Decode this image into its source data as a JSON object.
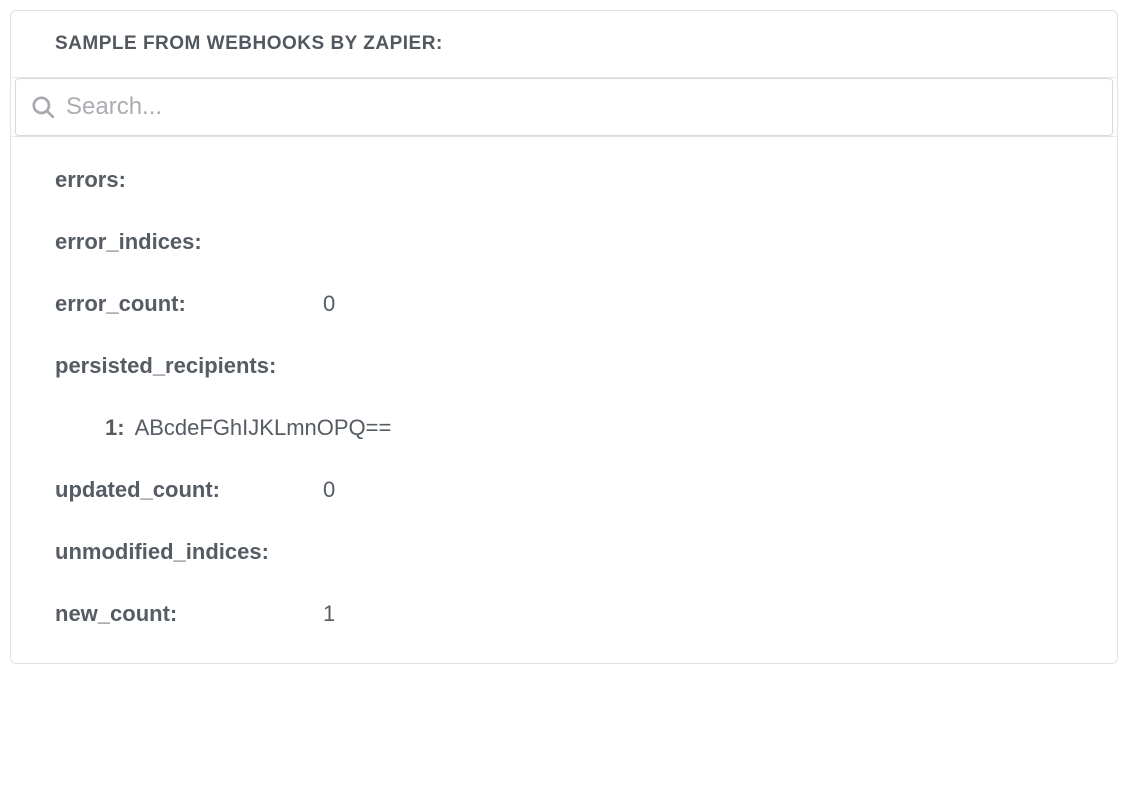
{
  "header": {
    "title": "SAMPLE FROM WEBHOOKS BY ZAPIER:"
  },
  "search": {
    "placeholder": "Search..."
  },
  "sample": {
    "errors": {
      "key": "errors:",
      "value": ""
    },
    "error_indices": {
      "key": "error_indices:",
      "value": ""
    },
    "error_count": {
      "key": "error_count:",
      "value": "0"
    },
    "persisted_recipients": {
      "key": "persisted_recipients:",
      "items": {
        "0": {
          "key": "1:",
          "value": "ABcdeFGhIJKLmnOPQ=="
        }
      }
    },
    "updated_count": {
      "key": "updated_count:",
      "value": "0"
    },
    "unmodified_indices": {
      "key": "unmodified_indices:",
      "value": ""
    },
    "new_count": {
      "key": "new_count:",
      "value": "1"
    }
  }
}
